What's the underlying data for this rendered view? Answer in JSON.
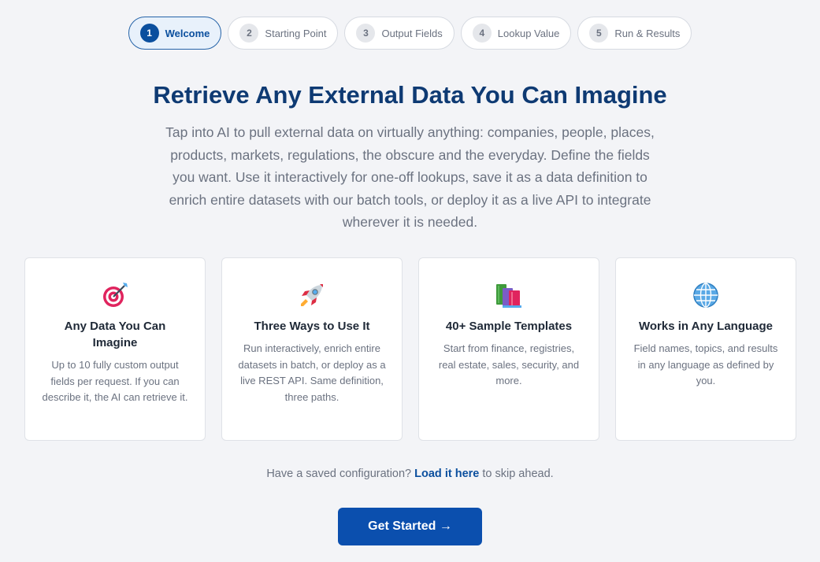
{
  "steps": [
    {
      "num": "1",
      "label": "Welcome",
      "active": true
    },
    {
      "num": "2",
      "label": "Starting Point",
      "active": false
    },
    {
      "num": "3",
      "label": "Output Fields",
      "active": false
    },
    {
      "num": "4",
      "label": "Lookup Value",
      "active": false
    },
    {
      "num": "5",
      "label": "Run & Results",
      "active": false
    }
  ],
  "hero": {
    "title": "Retrieve Any External Data You Can Imagine",
    "description": "Tap into AI to pull external data on virtually anything: companies, people, places, products, markets, regulations, the obscure and the everyday. Define the fields you want. Use it interactively for one-off lookups, save it as a data definition to enrich entire datasets with our batch tools, or deploy it as a live API to integrate wherever it is needed."
  },
  "cards": [
    {
      "icon": "target-icon",
      "title": "Any Data You Can Imagine",
      "body": "Up to 10 fully custom output fields per request. If you can describe it, the AI can retrieve it."
    },
    {
      "icon": "rocket-icon",
      "title": "Three Ways to Use It",
      "body": "Run interactively, enrich entire datasets in batch, or deploy as a live REST API. Same definition, three paths."
    },
    {
      "icon": "books-icon",
      "title": "40+ Sample Templates",
      "body": "Start from finance, registries, real estate, sales, security, and more."
    },
    {
      "icon": "globe-icon",
      "title": "Works in Any Language",
      "body": "Field names, topics, and results in any language as defined by you."
    }
  ],
  "saved": {
    "prefix": "Have a saved configuration?",
    "link": "Load it here",
    "suffix": "to skip ahead."
  },
  "cta": {
    "label": "Get Started →"
  },
  "colors": {
    "accent": "#0b4fae",
    "title": "#0e3a73",
    "background": "#f3f4f7"
  }
}
